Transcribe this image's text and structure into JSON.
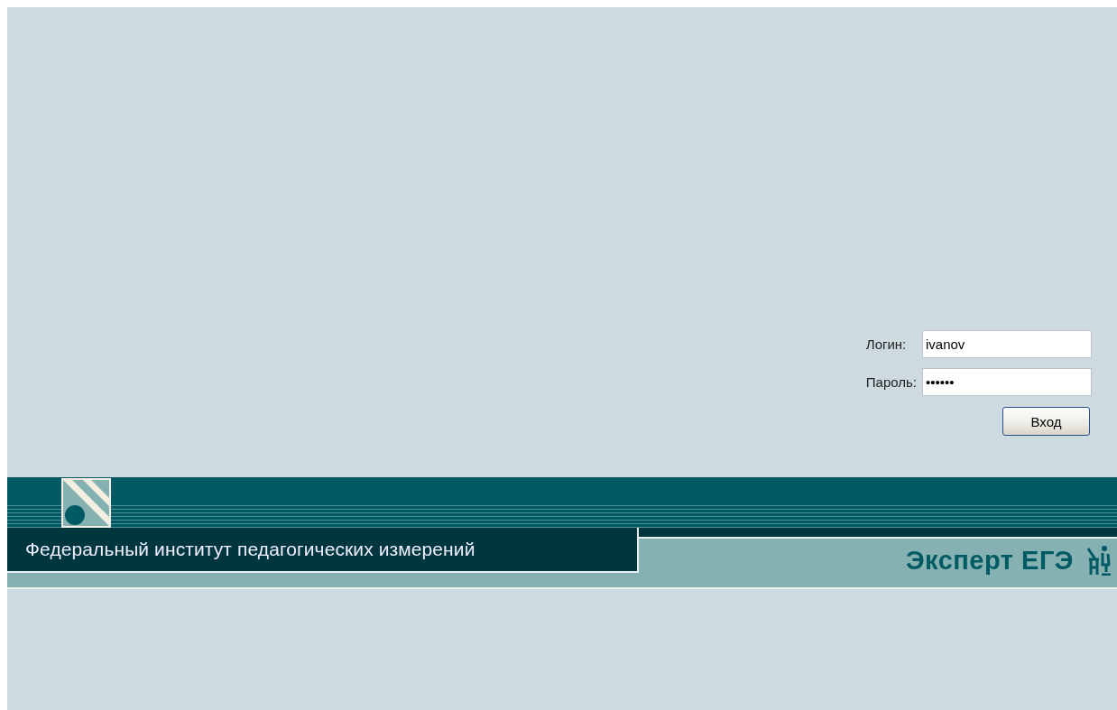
{
  "login_form": {
    "fields": [
      {
        "label": "Логин:",
        "value": "ivanov"
      },
      {
        "label": "Пароль:",
        "value": "••••••"
      }
    ],
    "submit_button": "Вход"
  },
  "banner": {
    "organization": "Федеральный институт педагогических измерений",
    "product": "Эксперт ЕГЭ"
  }
}
